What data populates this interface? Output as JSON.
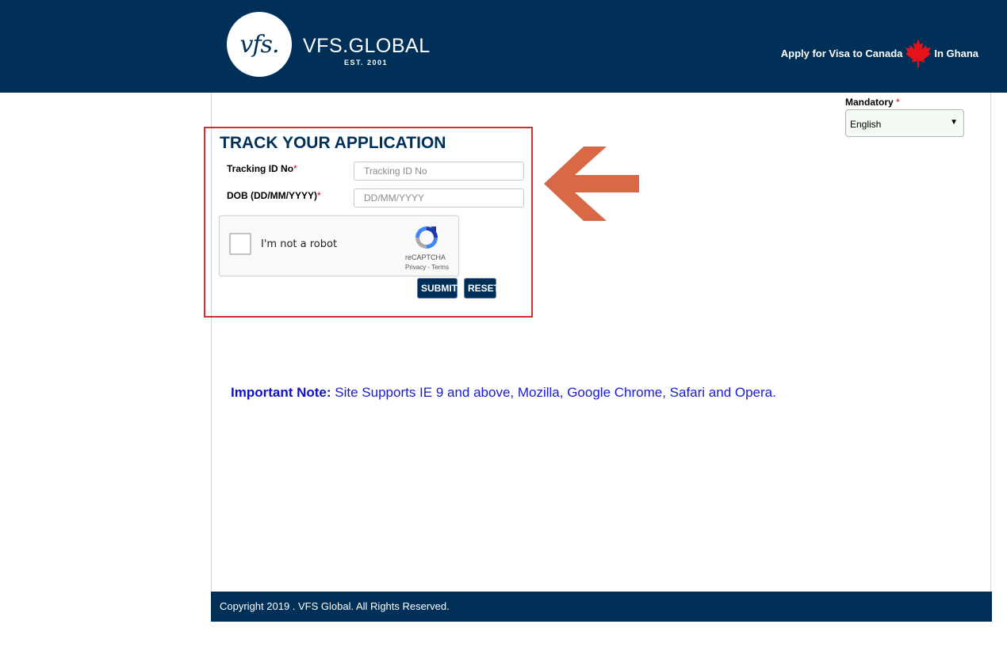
{
  "header": {
    "logo_text": "vfs.",
    "brand": "VFS.GLOBAL",
    "est": "EST. 2001",
    "apply_text": "Apply for Visa to Canada",
    "location_text": "In Ghana",
    "flag_icon": "maple-leaf-icon"
  },
  "language": {
    "label": "Mandatory",
    "required_mark": "*",
    "selected": "English"
  },
  "track": {
    "title": "TRACK YOUR APPLICATION",
    "tracking_label": "Tracking ID No",
    "tracking_placeholder": "Tracking ID No",
    "dob_label": "DOB (DD/MM/YYYY)",
    "dob_placeholder": "DD/MM/YYYY",
    "required_mark": "*",
    "submit_label": "SUBMIT",
    "reset_label": "RESET"
  },
  "recaptcha": {
    "label": "I'm not a robot",
    "brand": "reCAPTCHA",
    "links": "Privacy - Terms"
  },
  "note": {
    "bold": "Important Note:",
    "text": " Site Supports IE 9 and above, Mozilla, Google Chrome, Safari and Opera."
  },
  "footer": {
    "copyright": "Copyright 2019 . VFS Global. All Rights Reserved."
  },
  "colors": {
    "header_bg": "#003057",
    "highlight_border": "#d32f2f",
    "arrow": "#d96846",
    "note": "#1a1ad6"
  }
}
